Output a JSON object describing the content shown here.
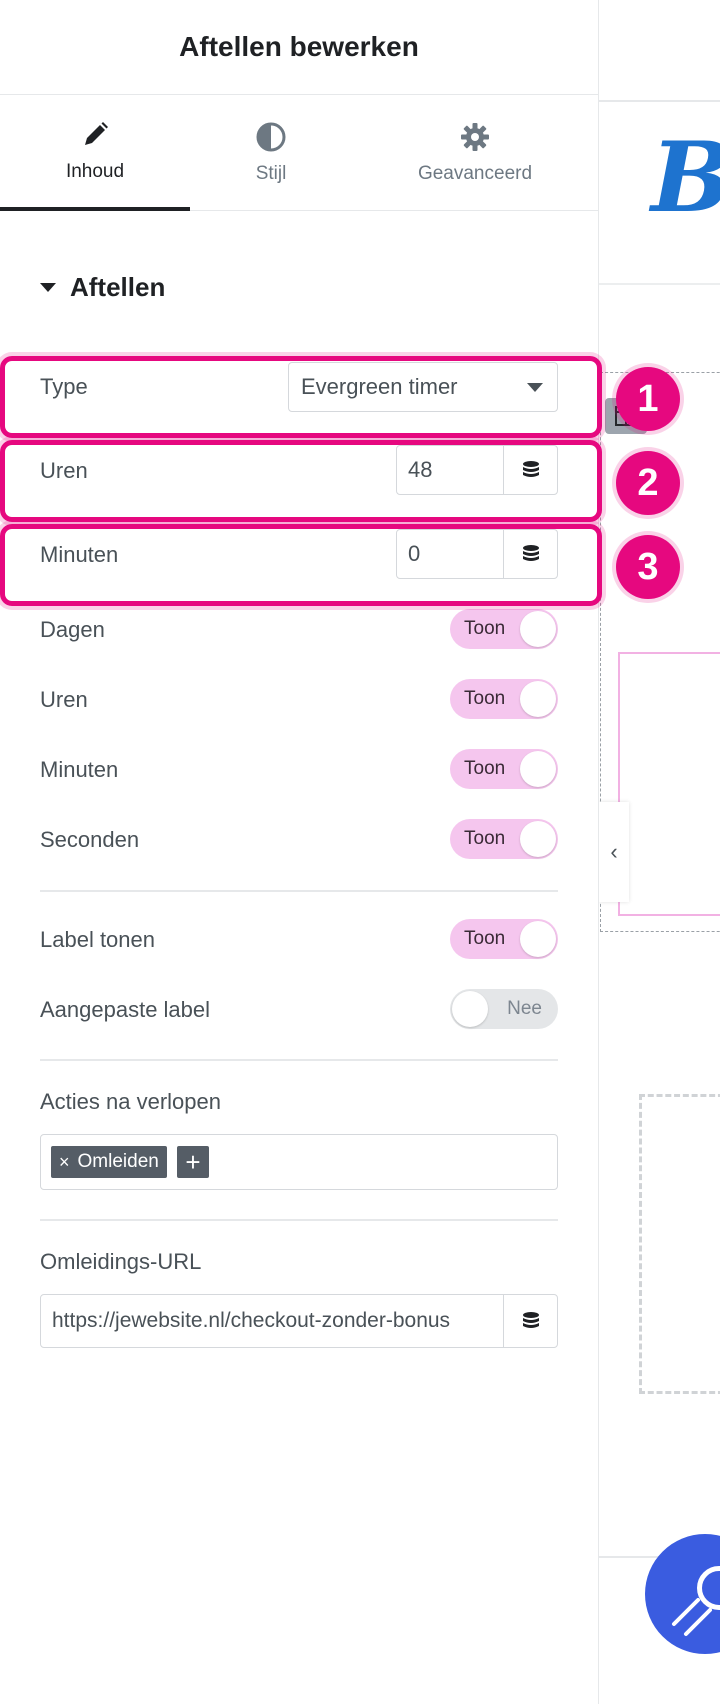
{
  "panel": {
    "title": "Aftellen bewerken",
    "tabs": [
      {
        "label": "Inhoud",
        "icon": "pencil-icon",
        "active": true
      },
      {
        "label": "Stijl",
        "icon": "contrast-icon",
        "active": false
      },
      {
        "label": "Geavanceerd",
        "icon": "gear-icon",
        "active": false
      }
    ],
    "section_title": "Aftellen"
  },
  "fields": {
    "type": {
      "label": "Type",
      "value": "Evergreen timer"
    },
    "hours": {
      "label": "Uren",
      "value": "48"
    },
    "minutes": {
      "label": "Minuten",
      "value": "0"
    }
  },
  "annotations": [
    "1",
    "2",
    "3"
  ],
  "toggles": [
    {
      "label": "Dagen",
      "state": "Toon",
      "on": true
    },
    {
      "label": "Uren",
      "state": "Toon",
      "on": true
    },
    {
      "label": "Minuten",
      "state": "Toon",
      "on": true
    },
    {
      "label": "Seconden",
      "state": "Toon",
      "on": true
    },
    {
      "label": "Label tonen",
      "state": "Toon",
      "on": true
    },
    {
      "label": "Aangepaste label",
      "state": "Nee",
      "on": false
    }
  ],
  "actions": {
    "label": "Acties na verlopen",
    "tags": [
      "Omleiden"
    ],
    "remove_symbol": "×",
    "add_symbol": "+"
  },
  "redirect": {
    "label": "Omleidings-URL",
    "value": "https://jewebsite.nl/checkout-zonder-bonus"
  },
  "canvas": {
    "logo_text": "B",
    "collapse_symbol": "‹"
  },
  "colors": {
    "highlight": "#e6087f",
    "toggle_on": "#f5c6ee",
    "logo_blue": "#1e73cf",
    "fab_blue": "#3a5ce0"
  }
}
